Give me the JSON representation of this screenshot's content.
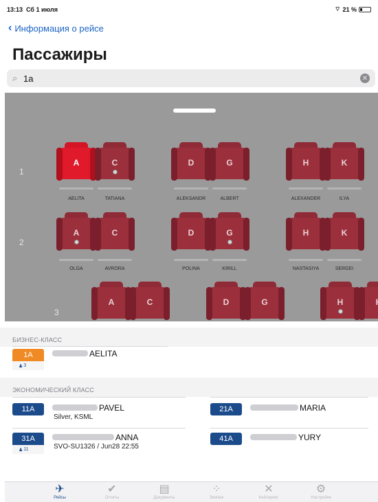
{
  "status": {
    "time": "13:13",
    "date": "Сб 1 июля",
    "battery": "21 %"
  },
  "nav": {
    "back_label": "Информация о рейсе"
  },
  "page": {
    "title": "Пассажиры"
  },
  "search": {
    "value": "1a"
  },
  "seatmap": {
    "rows": [
      {
        "number": "1",
        "seats": [
          "A",
          "C",
          "D",
          "G",
          "H",
          "K"
        ],
        "names": [
          "AELITA",
          "TATIANA",
          "ALEKSANDR",
          "ALBERT",
          "ALEXANDER",
          "ILYA"
        ]
      },
      {
        "number": "2",
        "seats": [
          "A",
          "C",
          "D",
          "G",
          "H",
          "K"
        ],
        "names": [
          "OLGA",
          "AVRORA",
          "POLINA",
          "KIRILL",
          "NASTASIYA",
          "SERGEI"
        ]
      },
      {
        "number": "3",
        "seats": [
          "A",
          "C",
          "D",
          "G",
          "H",
          "K"
        ],
        "names": []
      }
    ],
    "highlighted_seat": "1A"
  },
  "business": {
    "header": "БИЗНЕС-КЛАСС",
    "passengers": [
      {
        "seat": "1A",
        "first_name": "AELITA",
        "sub": "3"
      }
    ]
  },
  "economy": {
    "header": "ЭКОНОМИЧЕСКИЙ КЛАСС",
    "passengers": [
      {
        "seat": "11A",
        "first_name": "PAVEL",
        "details": "Silver, KSML"
      },
      {
        "seat": "21A",
        "first_name": "MARIA"
      },
      {
        "seat": "31A",
        "first_name": "ANNA",
        "details": "SVO-SU1326 / Jun28 22:55",
        "sub": "11"
      },
      {
        "seat": "41A",
        "first_name": "YURY"
      }
    ]
  },
  "tabs": [
    {
      "icon": "airplane-icon",
      "label": "Рейсы"
    },
    {
      "icon": "check-circle-icon",
      "label": "Отчеты"
    },
    {
      "icon": "document-icon",
      "label": "Документы"
    },
    {
      "icon": "people-icon",
      "label": "Экипаж"
    },
    {
      "icon": "utensils-icon",
      "label": "Кейтеринг"
    },
    {
      "icon": "gear-icon",
      "label": "Настройки"
    }
  ],
  "colors": {
    "accent": "#1a63c4",
    "economy_badge": "#1c4b8c",
    "business_badge": "#f08a24",
    "seat": "#9c2f3c",
    "seat_selected": "#e0192b"
  }
}
